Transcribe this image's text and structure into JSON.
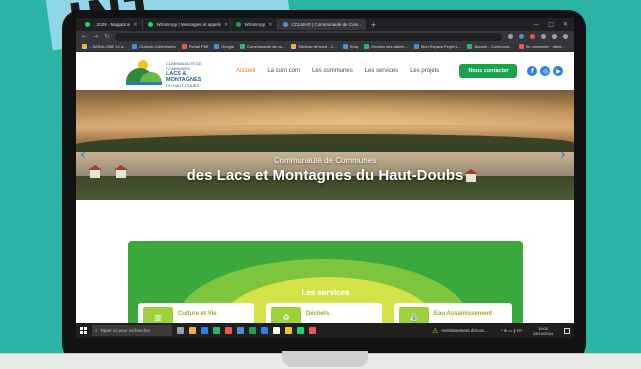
{
  "banner": {
    "text": "INT"
  },
  "browser": {
    "tabs": [
      {
        "title": "...2026 - Magazine",
        "favicon": "green"
      },
      {
        "title": "WhatsApp | Messages et appels",
        "favicon": "green"
      },
      {
        "title": "WhatsApp",
        "favicon": "green"
      },
      {
        "title": "CCLMHD | Communauté de Com...",
        "favicon": "blue"
      }
    ],
    "new_tab": "+",
    "window_controls": [
      "—",
      "□",
      "✕"
    ],
    "back": "←",
    "forward": "→",
    "reload": "↻",
    "bookmarks": [
      "...SARALONE 12 a...",
      "Outlook Collectivités",
      "Portail PMI",
      "Google",
      "Communauté de co...",
      "Tableau de bord - C...",
      "Kroq",
      "Gestion des admin...",
      "Mon Espace Projet L...",
      "Accueil - Communa...",
      "Se connecter · ident..."
    ]
  },
  "site": {
    "logo_line1": "COMMUNAUTÉ DE COMMUNES",
    "logo_line2": "LACS &",
    "logo_line3": "MONTAGNES",
    "logo_line4": "DU HAUT-DOUBS",
    "nav": [
      {
        "label": "Accueil",
        "active": true
      },
      {
        "label": "La com com",
        "active": false
      },
      {
        "label": "Les communes",
        "active": false
      },
      {
        "label": "Les services",
        "active": false
      },
      {
        "label": "Les projets",
        "active": false
      }
    ],
    "contact_button": "Nous contacter",
    "social": [
      "f",
      "◎",
      "▶"
    ],
    "hero_subtitle": "Communauté de Communes",
    "hero_title": "des Lacs et Montagnes du Haut-Doubs",
    "arrow_prev": "‹",
    "arrow_next": "›",
    "services_title": "Les services",
    "services": [
      {
        "label": "Culture et Vie"
      },
      {
        "label": "Déchets"
      },
      {
        "label": "Eau Assainissement"
      }
    ]
  },
  "taskbar": {
    "search_placeholder": "Taper ici pour rechercher",
    "warning_text": "Avertissement d'écon...",
    "tray_text": "^ ⊕ ▭ 𝄞 FR",
    "time": "10:00",
    "date": "28/10/2024"
  },
  "colors": {
    "background": "#2bb3a6",
    "accent_green": "#19a34a",
    "nav_active": "#e07a2e",
    "social_blue": "#2f80ed"
  }
}
